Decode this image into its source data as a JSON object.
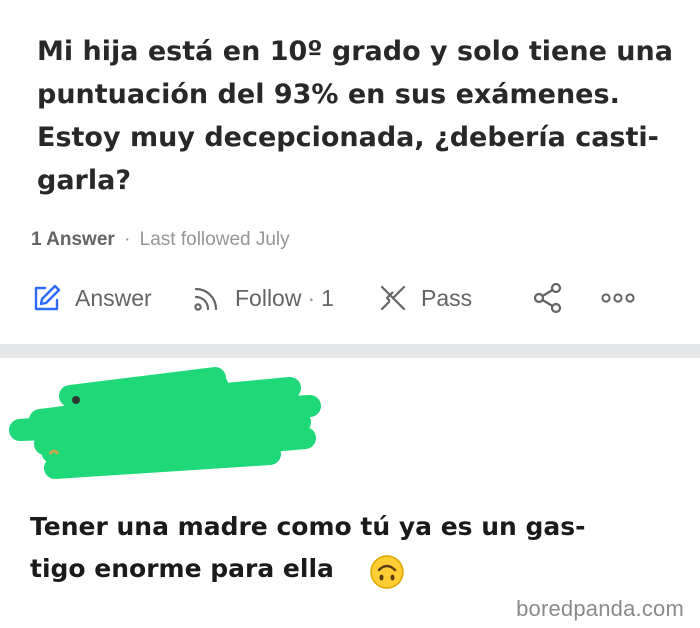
{
  "question": {
    "title": "Mi hija está en 10º grado y solo tiene una\npuntuación del 93% en sus exámenes.\nEstoy muy decepcionada, ¿debería casti-\ngarla?",
    "answer_count": "1 Answer",
    "separator": "·",
    "last_followed": "Last followed July"
  },
  "actions": {
    "answer_label": "Answer",
    "follow_label": "Follow",
    "follow_separator": "·",
    "follow_count": "1",
    "pass_label": "Pass",
    "answer_icon": "edit-icon",
    "follow_icon": "rss-feed-icon",
    "pass_icon": "pass-cross-icon",
    "share_icon": "share-icon",
    "more_icon": "more-dots-icon"
  },
  "answer": {
    "text": "Tener una madre como tú ya es un gas-\ntigo enorme para ella",
    "emoji": "upside-down-face-emoji",
    "redaction_color": "#1fd979"
  },
  "watermark": "boredpanda.com",
  "colors": {
    "accent": "#2e69ff",
    "text": "#282829",
    "muted": "#939598",
    "divider": "#e6e7e8"
  }
}
